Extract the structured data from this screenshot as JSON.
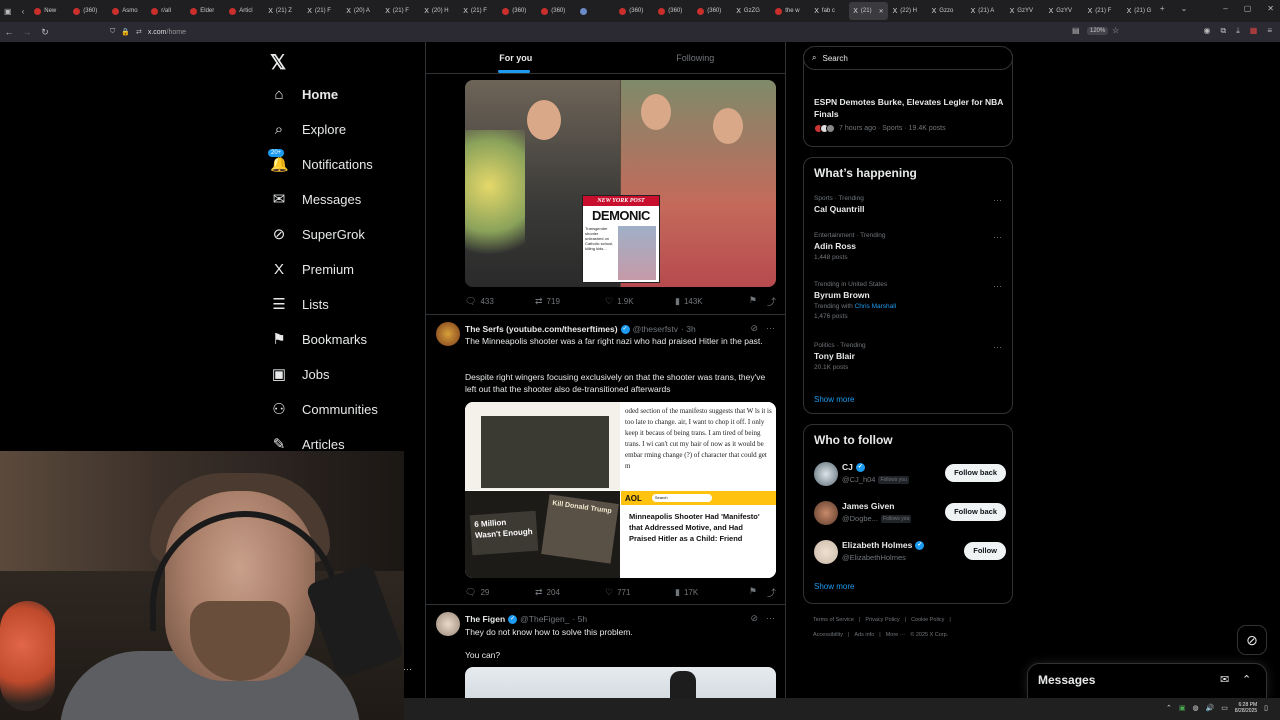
{
  "browser": {
    "tabs": [
      {
        "label": "New",
        "fav": "red"
      },
      {
        "label": "(360)",
        "fav": "red"
      },
      {
        "label": "Asmo",
        "fav": "red"
      },
      {
        "label": "r/all",
        "fav": "red"
      },
      {
        "label": "Elder",
        "fav": "red"
      },
      {
        "label": "Articl",
        "fav": "red"
      },
      {
        "label": "(21) Z",
        "fav": "x"
      },
      {
        "label": "(21) F",
        "fav": "x"
      },
      {
        "label": "(20) A",
        "fav": "x"
      },
      {
        "label": "(21) F",
        "fav": "x"
      },
      {
        "label": "(20) H",
        "fav": "x"
      },
      {
        "label": "(21) F",
        "fav": "x"
      },
      {
        "label": "(360)",
        "fav": "red"
      },
      {
        "label": "(360)",
        "fav": "red"
      },
      {
        "label": "",
        "fav": "blue"
      },
      {
        "label": "(360)",
        "fav": "red"
      },
      {
        "label": "(360)",
        "fav": "red"
      },
      {
        "label": "(360)",
        "fav": "red"
      },
      {
        "label": "GzZG",
        "fav": "x"
      },
      {
        "label": "the w",
        "fav": "red"
      },
      {
        "label": "fab c",
        "fav": "x"
      },
      {
        "label": "(21)",
        "fav": "x",
        "active": true
      },
      {
        "label": "(22) H",
        "fav": "x"
      },
      {
        "label": "Gzzo",
        "fav": "x"
      },
      {
        "label": "(21) A",
        "fav": "x"
      },
      {
        "label": "GzYV",
        "fav": "x"
      },
      {
        "label": "GzYV",
        "fav": "x"
      },
      {
        "label": "(21) F",
        "fav": "x"
      },
      {
        "label": "(21) G",
        "fav": "x"
      }
    ],
    "url_host": "x.com",
    "url_path": "/home",
    "zoom": "120%"
  },
  "nav": {
    "items": [
      {
        "name": "home",
        "icon": "⌂",
        "label": "Home"
      },
      {
        "name": "explore",
        "icon": "⌕",
        "label": "Explore"
      },
      {
        "name": "notifications",
        "icon": "🔔",
        "label": "Notifications"
      },
      {
        "name": "messages",
        "icon": "✉",
        "label": "Messages"
      },
      {
        "name": "supergrok",
        "icon": "⊘",
        "label": "SuperGrok"
      },
      {
        "name": "premium",
        "icon": "X",
        "label": "Premium"
      },
      {
        "name": "lists",
        "icon": "☰",
        "label": "Lists"
      },
      {
        "name": "bookmarks",
        "icon": "⚑",
        "label": "Bookmarks"
      },
      {
        "name": "jobs",
        "icon": "▣",
        "label": "Jobs"
      },
      {
        "name": "communities",
        "icon": "⚇",
        "label": "Communities"
      },
      {
        "name": "articles",
        "icon": "✎",
        "label": "Articles"
      }
    ],
    "notif_badge": "20+"
  },
  "feed": {
    "tabs": [
      "For you",
      "Following"
    ],
    "post1": {
      "nyp_header": "NEW YORK POST",
      "nyp_title": "DEMONIC",
      "nyp_body": "Transgender shooter unleashed on Catholic school, killing kids...",
      "replies": "433",
      "reposts": "719",
      "likes": "1.9K",
      "views": "143K"
    },
    "post2": {
      "name": "The Serfs (youtube.com/theserftimes)",
      "handle": "@theserfstv",
      "time": "· 3h",
      "text1": "The Minneapolis shooter was a far right nazi who had praised Hitler in the past.",
      "text2": "Despite right wingers focusing exclusively on that the shooter was trans, they've left out that the shooter also de-transitioned afterwards",
      "manifesto_text": "oded section of the manifesto suggests that W ls it is too late to change. air, I want to chop it off. I only keep it becaus of being trans. I am tired of being trans. I wi can't cut my hair of now as it would be embar rming change (?) of character that could get m",
      "sign1": "6 Million Wasn't Enough",
      "sign2": "Kill Donald Trump",
      "aol_logo": "AOL",
      "aol_search": "Search",
      "aol_headline": "Minneapolis Shooter Had 'Manifesto' that Addressed Motive, and Had Praised Hitler as a Child: Friend",
      "replies": "29",
      "reposts": "204",
      "likes": "771",
      "views": "17K"
    },
    "post3": {
      "name": "The Figen",
      "handle": "@TheFigen_",
      "time": "· 5h",
      "text1": "They do not know how to solve this problem.",
      "text2": "You can?"
    }
  },
  "right": {
    "search_placeholder": "Search",
    "news": {
      "title": "ESPN Demotes Burke, Elevates Legler for NBA Finals",
      "meta": "7 hours ago · Sports · 19.4K posts"
    },
    "happening_title": "What’s happening",
    "trends": [
      {
        "ctx": "Sports · Trending",
        "name": "Cal Quantrill",
        "count": ""
      },
      {
        "ctx": "Entertainment · Trending",
        "name": "Adin Ross",
        "count": "1,448 posts"
      },
      {
        "ctx": "Trending in United States",
        "name": "Byrum Brown",
        "with_prefix": "Trending with",
        "with_link": "Chris Marshall",
        "count": "1,476 posts"
      },
      {
        "ctx": "Politics · Trending",
        "name": "Tony Blair",
        "count": "20.1K posts"
      }
    ],
    "show_more": "Show more",
    "who_title": "Who to follow",
    "who": [
      {
        "name": "CJ",
        "handle": "@CJ_h04",
        "follows_you": "Follows you",
        "button": "Follow back",
        "verified": true
      },
      {
        "name": "James Given",
        "handle": "@Dogbe...",
        "follows_you": "Follows you",
        "button": "Follow back",
        "verified": false
      },
      {
        "name": "Elizabeth Holmes",
        "handle": "@ElizabethHolmes",
        "follows_you": "",
        "button": "Follow",
        "verified": true
      }
    ],
    "footer": [
      "Terms of Service",
      "|",
      "Privacy Policy",
      "|",
      "Cookie Policy",
      "|",
      "Accessibility",
      "|",
      "Ads info",
      "|",
      "More ···",
      "© 2025 X Corp."
    ]
  },
  "drawer": {
    "title": "Messages"
  },
  "taskbar": {
    "time": "6:28 PM",
    "date": "8/28/2025"
  }
}
